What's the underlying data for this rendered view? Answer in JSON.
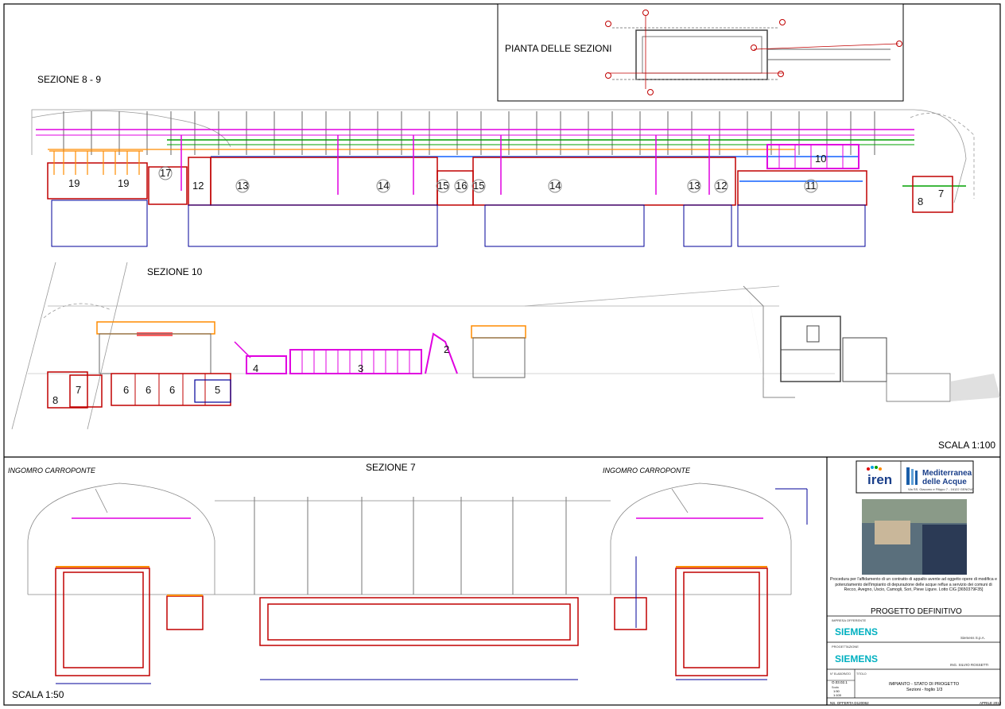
{
  "sections": {
    "sezione_8_9": "SEZIONE 8 - 9",
    "sezione_10": "SEZIONE 10",
    "sezione_7": "SEZIONE 7",
    "pianta": "PIANTA DELLE SEZIONI",
    "scala_100": "SCALA 1:100",
    "scala_50": "SCALA 1:50",
    "ingombro_left": "INGOMRO CARROPONTE",
    "ingombro_right": "INGOMRO CARROPONTE"
  },
  "top_numbers": [
    "19",
    "19",
    "17",
    "12",
    "13",
    "14",
    "15",
    "16",
    "15",
    "14",
    "13",
    "12",
    "11",
    "10",
    "8",
    "7"
  ],
  "mid_numbers": [
    "8",
    "7",
    "6",
    "6",
    "6",
    "5",
    "4",
    "3",
    "2"
  ],
  "title_block": {
    "iren": "iren",
    "mediterranea_1": "Mediterranea",
    "mediterranea_2": "delle Acque",
    "mediterranea_addr": "Via SS. Giacomo e Filippo 7 - 16122 GENOVA",
    "description": "Procedura per l'affidamento di un contratto di appalto avente ad oggetto opere di modifica e potenziamento dell'impianto di depurazione delle acque reflue a servizio dei comuni di Recco, Avegno, Uscio, Camogli, Sori, Pieve Ligure. Lotto CIG [3650379F35]",
    "progetto": "PROGETTO DEFINITIVO",
    "impresa_label": "IMPRESA OFFERENTE",
    "siemens_1": "SIEMENS",
    "siemens_spa": "Siemens S.p.A.",
    "progettazione_label": "PROGETTAZIONE",
    "siemens_2": "SIEMENS",
    "ing": "ING. SILVIO ROSSETTI",
    "num_label": "N° ELABORATO",
    "titolo_label": "TITOLO",
    "num_value": "O.03.02.1",
    "scala_label": "Scala",
    "scala_value_1": "1:50",
    "scala_value_2": "1:100",
    "impianto": "IMPIANTO - STATO DI PROGETTO",
    "sezioni_foglio": "Sezioni - foglio 1/3",
    "offerta": "NS. OFFERTA D120062",
    "data": "APRILE 2012"
  },
  "colors": {
    "magenta": "#e000e0",
    "red": "#c00000",
    "blue": "#00009a",
    "green": "#00a000",
    "orange": "#ff8c00",
    "gray": "#555555"
  }
}
